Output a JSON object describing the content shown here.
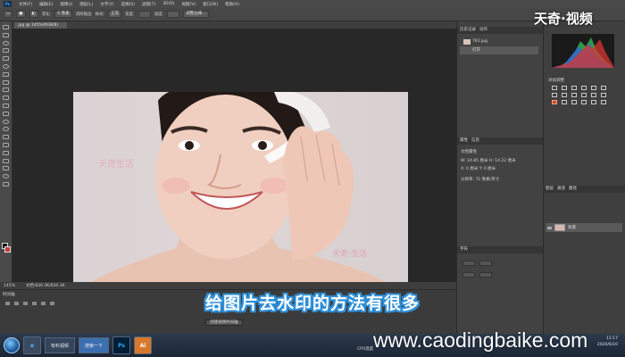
{
  "app": {
    "logo": "Ps",
    "menu": [
      "文件(F)",
      "编辑(E)",
      "图像(I)",
      "图层(L)",
      "文字(Y)",
      "选择(S)",
      "滤镜(T)",
      "3D(D)",
      "视图(V)",
      "窗口(W)",
      "帮助(H)"
    ]
  },
  "options": {
    "feather_label": "羽化:",
    "feather_value": "0 像素",
    "antialias_label": "消除锯齿",
    "style_label": "样式:",
    "style_value": "正常",
    "width_label": "宽度:",
    "height_label": "高度:",
    "refine_button": "调整边缘..."
  },
  "document": {
    "tab_label": ".jpg @ 145%(RGB/8)",
    "zoom": "145%",
    "doc_size": "文档:830.3K/830.3K"
  },
  "canvas": {
    "watermark_1": "天奇生活",
    "watermark_2": "天奇·生活"
  },
  "timeline": {
    "title": "时间轴",
    "create_button": "创建视频时间轴"
  },
  "panels": {
    "history_tabs": [
      "历史记录",
      "动作"
    ],
    "history_items": [
      "761.jpg",
      "打开"
    ],
    "properties_tabs": [
      "属性",
      "信息"
    ],
    "properties_title": "文档属性",
    "w_label": "W:",
    "w_value": "24.85 厘米",
    "h_label": "H:",
    "h_value": "14.22 厘米",
    "x_label": "X:",
    "x_value": "0 厘米",
    "y_label": "Y:",
    "y_value": "0 厘米",
    "resolution": "分辨率: 72 像素/英寸",
    "char_tab": "字符",
    "adjust_title": "添加调整",
    "layers_tabs": [
      "图层",
      "通道",
      "路径"
    ],
    "layer_name": "背景",
    "opacity_value": "100%",
    "fill_value": "100%"
  },
  "overlays": {
    "subtitle": "给图片去水印的方法有很多",
    "site_url": "www.caodingbaike.com",
    "brand": "天奇·视频"
  },
  "taskbar": {
    "apps": [
      "e",
      "Ps",
      "Ai"
    ],
    "active_window": "有料视频",
    "search_window": "搜索一下",
    "clock_time": "11:17",
    "clock_date": "2020/6/10",
    "cpu_label": "CPU温度"
  }
}
